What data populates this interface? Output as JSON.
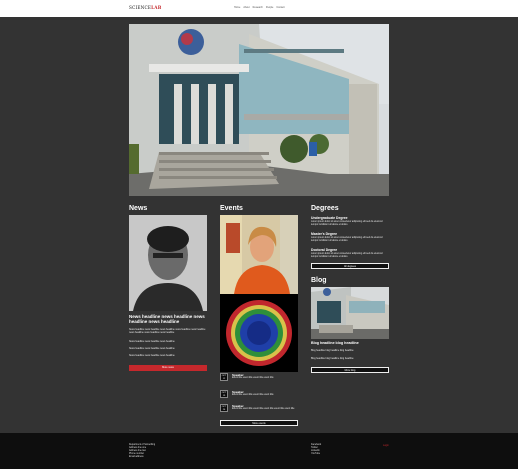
{
  "header": {
    "logo_text": "SCIENCE",
    "logo_accent": "LAB",
    "nav_items": [
      "Home",
      "About",
      "Research",
      "People",
      "Contact"
    ]
  },
  "news": {
    "heading": "News",
    "headline": "News headline news headline news headline news headline",
    "paragraph": "News headline news headline news headline news headline news headline news headline news headline news headline",
    "items": [
      "News headline news headline news headline",
      "News headline news headline news headline",
      "News headline news headline news headline"
    ],
    "button": "More news"
  },
  "events": {
    "heading": "Events",
    "list": [
      {
        "month": "OCT",
        "day": "12",
        "title": "Speaker",
        "desc": "Event title event title event title event title"
      },
      {
        "month": "OCT",
        "day": "19",
        "title": "Speaker",
        "desc": "Event title event title event title event title"
      },
      {
        "month": "OCT",
        "day": "26",
        "title": "Speaker",
        "desc": "Event title event title event title event title event title event title"
      }
    ],
    "button": "More events"
  },
  "degrees": {
    "heading": "Degrees",
    "items": [
      {
        "title": "Undergraduate Degree",
        "desc": "Lorem ipsum dolor sit amet consectetur adipiscing elit sed do eiusmod tempor incididunt ut labore et dolore"
      },
      {
        "title": "Master's Degree",
        "desc": "Lorem ipsum dolor sit amet consectetur adipiscing elit sed do eiusmod tempor incididunt ut labore et dolore"
      },
      {
        "title": "Doctoral Degree",
        "desc": "Lorem ipsum dolor sit amet consectetur adipiscing elit sed do eiusmod tempor incididunt ut labore et dolore"
      }
    ],
    "button": "All degrees"
  },
  "blog": {
    "heading": "Blog",
    "headline": "Blog headline blog headline",
    "items": [
      "Blog headline blog headline blog headline",
      "Blog headline blog headline blog headline"
    ],
    "button": "More blog"
  },
  "footer": {
    "left_links": [
      "Department of Something",
      "Address line one",
      "Address line two",
      "Phone number",
      "Email address"
    ],
    "right_links": [
      "Facebook",
      "Twitter",
      "LinkedIn",
      "YouTube"
    ],
    "accent_link": "Login"
  },
  "colors": {
    "accent": "#c5282c",
    "background": "#333333",
    "footer": "#0e0e0e"
  }
}
